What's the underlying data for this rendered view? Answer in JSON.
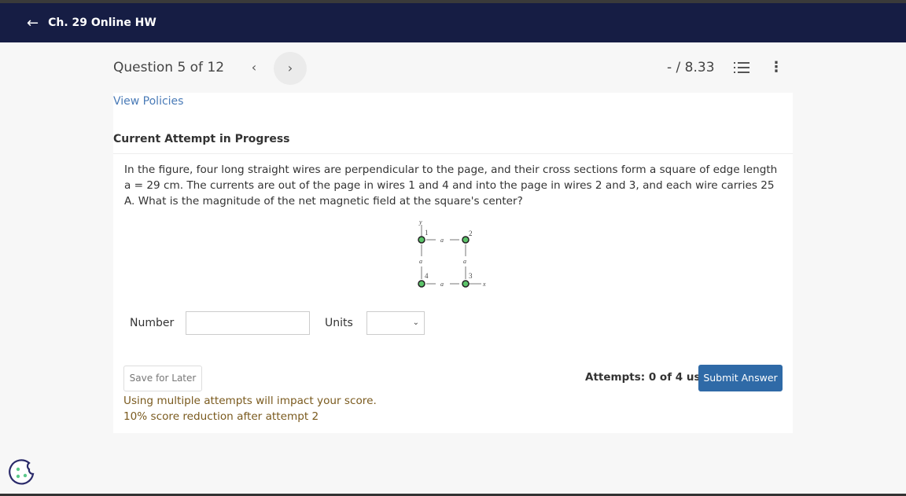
{
  "nav": {
    "back_icon": "arrow-left-icon",
    "title": "Ch. 29 Online HW"
  },
  "question_bar": {
    "title": "Question 5 of 12",
    "prev": "‹",
    "next": "›",
    "score": "- / 8.33",
    "list_icon": "numbered-list-icon",
    "more_icon": "⋮"
  },
  "card": {
    "view_policies": "View Policies",
    "attempt_heading": "Current Attempt in Progress",
    "question_text": "In the figure, four long straight wires are perpendicular to the page, and their cross sections form a square of edge length a = 29 cm. The currents are out of the page in wires 1 and 4 and into the page in wires 2 and 3, and each wire carries 25 A. What is the magnitude of the net magnetic field at the square's center?",
    "figure": {
      "y": "y",
      "x": "x",
      "a": "a",
      "w1": "1",
      "w2": "2",
      "w3": "3",
      "w4": "4",
      "wire_color": "#5cc46a"
    },
    "number_label": "Number",
    "number_value": "",
    "units_label": "Units",
    "units_value": "",
    "save_label": "Save for Later",
    "attempts": "Attempts: 0 of 4 used",
    "submit_label": "Submit Answer",
    "warning_1": "Using multiple attempts will impact your score.",
    "warning_2": "10% score reduction after attempt 2"
  },
  "colors": {
    "nav": "#161d44",
    "link": "#4a7bb7",
    "submit": "#2f6aa7",
    "warning": "#7a5a1e"
  }
}
